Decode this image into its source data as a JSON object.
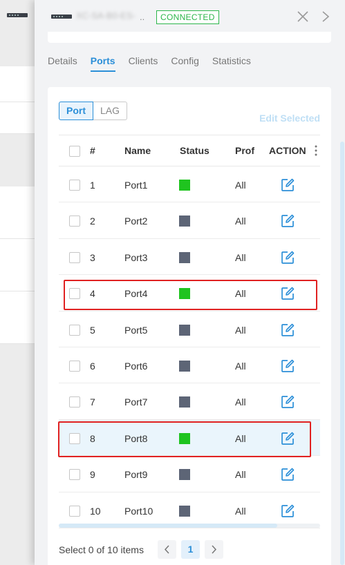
{
  "header": {
    "device_name": "XC-SA-B0-ES-",
    "dots": "..",
    "status_badge": "CONNECTED",
    "status_color": "#2cb64a",
    "close_icon": "close-icon",
    "next_icon": "chevron-right-icon"
  },
  "tabs": [
    {
      "label": "Details",
      "active": false
    },
    {
      "label": "Ports",
      "active": true
    },
    {
      "label": "Clients",
      "active": false
    },
    {
      "label": "Config",
      "active": false
    },
    {
      "label": "Statistics",
      "active": false
    }
  ],
  "port_toggle": {
    "options": [
      "Port",
      "LAG"
    ],
    "selected": "Port"
  },
  "edit_selected_label": "Edit Selected",
  "table": {
    "headers": {
      "number": "#",
      "name": "Name",
      "status": "Status",
      "profile": "Prof",
      "action": "ACTION"
    },
    "rows": [
      {
        "number": "1",
        "name": "Port1",
        "status": "up",
        "profile": "All"
      },
      {
        "number": "2",
        "name": "Port2",
        "status": "down",
        "profile": "All"
      },
      {
        "number": "3",
        "name": "Port3",
        "status": "down",
        "profile": "All"
      },
      {
        "number": "4",
        "name": "Port4",
        "status": "up",
        "profile": "All"
      },
      {
        "number": "5",
        "name": "Port5",
        "status": "down",
        "profile": "All"
      },
      {
        "number": "6",
        "name": "Port6",
        "status": "down",
        "profile": "All"
      },
      {
        "number": "7",
        "name": "Port7",
        "status": "down",
        "profile": "All"
      },
      {
        "number": "8",
        "name": "Port8",
        "status": "up",
        "profile": "All"
      },
      {
        "number": "9",
        "name": "Port9",
        "status": "down",
        "profile": "All"
      },
      {
        "number": "10",
        "name": "Port10",
        "status": "down",
        "profile": "All"
      }
    ],
    "status_colors": {
      "up": "#1fc41f",
      "down": "#5d6576"
    },
    "highlighted_row_index": 7
  },
  "footer": {
    "selection_text": "Select 0 of 10 items",
    "current_page": "1"
  },
  "annotations": {
    "outline_color": "#e02121",
    "boxed_rows": [
      3,
      7
    ]
  },
  "colors": {
    "accent": "#2b8fd8"
  }
}
